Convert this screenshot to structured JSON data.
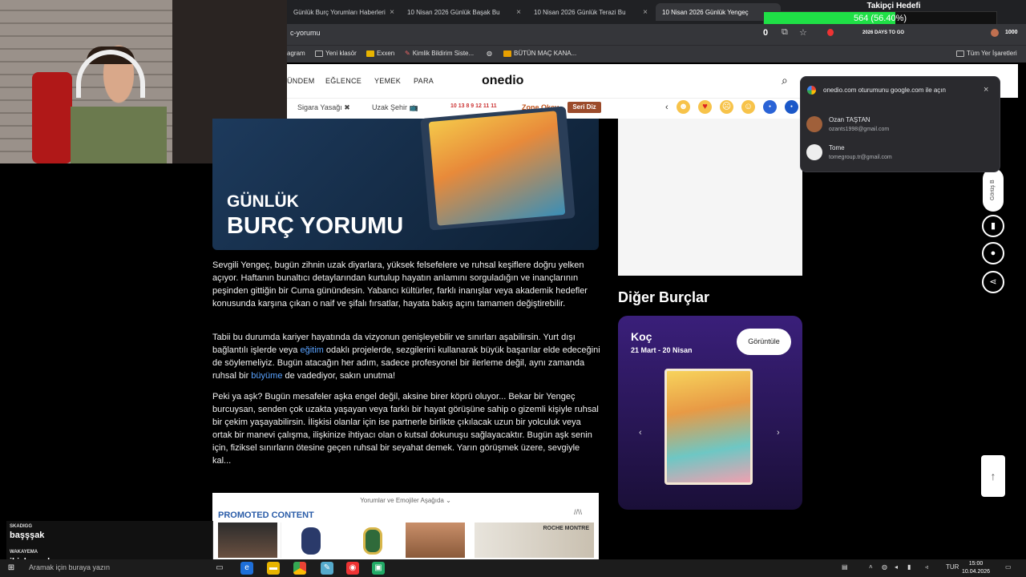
{
  "browser": {
    "tabs": [
      {
        "label": "Günlük Burç Yorumları Haberleri"
      },
      {
        "label": "10 Nisan 2026 Günlük Başak Bu"
      },
      {
        "label": "10 Nisan 2026 Günlük Terazi Bu"
      },
      {
        "label": "10 Nisan 2026 Günlük Yengeç"
      }
    ],
    "address": "c-yorumu",
    "bookmarks": [
      "agram",
      "Yeni klasör",
      "Exxen",
      "Kimlik Bildirim Siste...",
      "BÜTÜN MAÇ KANA..."
    ],
    "bookmarks_right": "Tüm Yer İşaretleri",
    "toolbar_counter": "0",
    "days_label": "2026 DAYS TO GO",
    "score": "1000"
  },
  "follower": {
    "title": "Takipçi Hedefi",
    "progress_text": "564 (56.40%)",
    "progress_fraction": 0.564
  },
  "site": {
    "nav": [
      "ÜNDEM",
      "EĞLENCE",
      "YEMEK",
      "PARA"
    ],
    "logo": "onedio",
    "chips": [
      "Sigara Yasağı ✖",
      "Uzak Şehir 📺",
      "Zone Okey"
    ],
    "numbers": "10 13 8 9 12 11 11",
    "seri_diz": "Seri Diz",
    "hero_line1": "GÜNLÜK",
    "hero_line2": "BURÇ YORUMU"
  },
  "article": {
    "p1": "Sevgili Yengeç, bugün zihnin uzak diyarlara, yüksek felsefelere ve ruhsal keşiflere doğru yelken açıyor. Haftanın bunaltıcı detaylarından kurtulup hayatın anlamını sorguladığın ve inançlarının peşinden gittiğin bir Cuma günündesin. Yabancı kültürler, farklı inanışlar veya akademik hedefler konusunda karşına çıkan o naif ve şifalı fırsatlar, hayata bakış açını tamamen değiştirebilir.",
    "p2a": "Tabii bu durumda kariyer hayatında da vizyonun genişleyebilir ve sınırları aşabilirsin. Yurt dışı bağlantılı işlerde veya ",
    "p2_link1": "eğitim",
    "p2b": " odaklı projelerde, sezgilerini kullanarak büyük başarılar elde edeceğini de söylemeliyiz. Bugün atacağın her adım, sadece profesyonel bir ilerleme değil, aynı zamanda ruhsal bir ",
    "p2_link2": "büyüme",
    "p2c": " de vadediyor, sakın unutma!",
    "p3": "Peki ya aşk? Bugün mesafeler aşka engel değil, aksine birer köprü oluyor... Bekar bir Yengeç burcuysan, senden çok uzakta yaşayan veya farklı bir hayat görüşüne sahip o gizemli kişiyle ruhsal bir çekim yaşayabilirsin. İlişkisi olanlar için ise partnerle birlikte çıkılacak uzun bir yolculuk veya ortak bir manevi çalışma, ilişkinize ihtiyacı olan o kutsal dokunuşu sağlayacaktır. Bugün aşk senin için, fiziksel sınırların ötesine geçen ruhsal bir seyahat demek. Yarın görüşmek üzere, sevgiyle kal...",
    "comments_toggle": "Yorumlar ve Emojiler Aşağıda ⌄",
    "promoted": "PROMOTED CONTENT",
    "promoted_logo": "//\\\\",
    "watch_brand": "ROCHE MONTRE"
  },
  "sidebar": {
    "heading": "Diğer Burçlar",
    "zodiac_name": "Koç",
    "zodiac_dates": "21 Mart - 20 Nisan",
    "view_button": "Görüntüle",
    "prev": "‹",
    "next": "›"
  },
  "google_popup": {
    "title": "onedio.com oturumunu google.com ile açın",
    "accounts": [
      {
        "name": "Ozan TAŞTAN",
        "email": "ozants1998@gmail.com"
      },
      {
        "name": "Tome",
        "email": "tomegroup.tr@gmail.com"
      }
    ]
  },
  "side_actions": {
    "pill": "Görüş B"
  },
  "chat": {
    "messages": [
      {
        "user": "SKADIGG",
        "text": "başşşak"
      },
      {
        "user": "WAKAYEMA",
        "text": "ikizler yok mu"
      }
    ]
  },
  "taskbar": {
    "search_placeholder": "Aramak için buraya yazın",
    "lang": "TUR",
    "time": "15:00",
    "date": "10.04.2026"
  },
  "colors": {
    "follower_green": "#1fe046",
    "link": "#5aa3ff",
    "zodiac_card": "#3a1f7a",
    "seri_diz": "#9b4b2b"
  }
}
